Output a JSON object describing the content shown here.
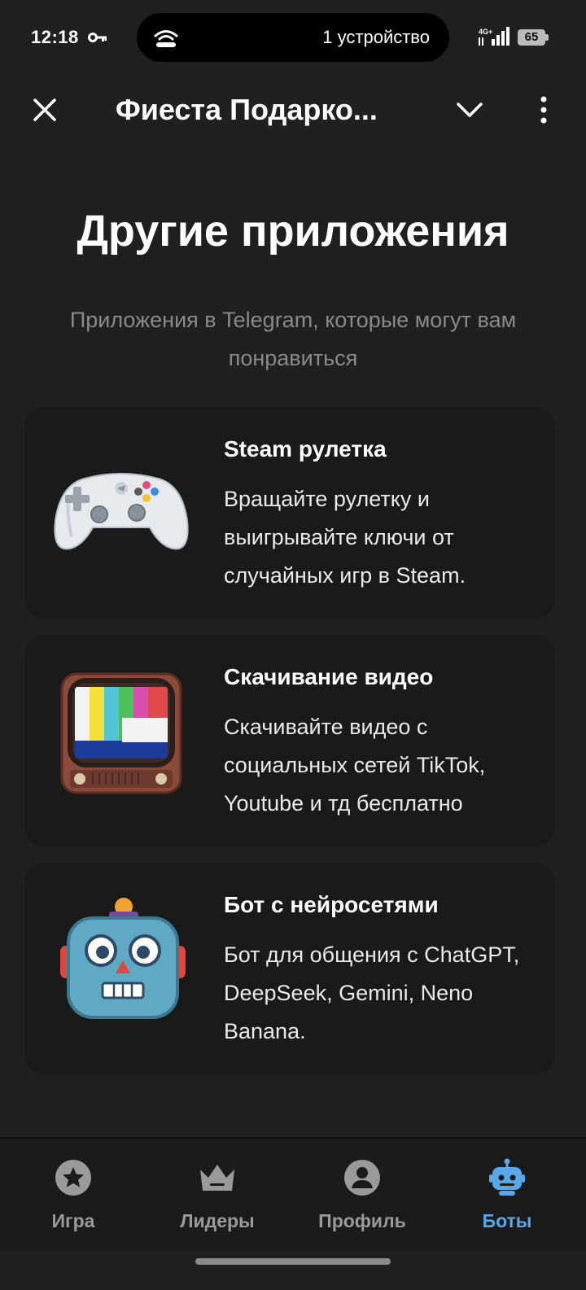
{
  "status_bar": {
    "time": "12:18",
    "key_icon": "key-icon",
    "connection_text": "1 устройство",
    "signal_label": "4G+",
    "battery": "65"
  },
  "header": {
    "title": "Фиеста Подарко...",
    "close_icon": "close-icon",
    "expand_icon": "chevron-down-icon",
    "more_icon": "more-vertical-icon"
  },
  "main": {
    "title": "Другие приложения",
    "subtitle": "Приложения в Telegram, которые могут вам понравиться",
    "cards": [
      {
        "title": "Steam рулетка",
        "description": "Вращайте рулетку и выигрывайте ключи от случайных игр в Steam.",
        "icon": "gamepad-icon"
      },
      {
        "title": "Скачивание видео",
        "description": "Скачивайте видео с социальных сетей TikTok, Youtube и тд бесплатно",
        "icon": "tv-icon"
      },
      {
        "title": "Бот с нейросетями",
        "description": "Бот для общения с ChatGPT, DeepSeek, Gemini, Neno Banana.",
        "icon": "robot-icon"
      }
    ]
  },
  "bottom_nav": {
    "items": [
      {
        "label": "Игра",
        "icon": "star-icon",
        "active": false
      },
      {
        "label": "Лидеры",
        "icon": "crown-icon",
        "active": false
      },
      {
        "label": "Профиль",
        "icon": "user-icon",
        "active": false
      },
      {
        "label": "Боты",
        "icon": "robot-icon",
        "active": true
      }
    ]
  },
  "colors": {
    "background": "#202020",
    "card": "#1a1a1a",
    "accent": "#5aa8ea",
    "muted": "#8a8a8a"
  }
}
